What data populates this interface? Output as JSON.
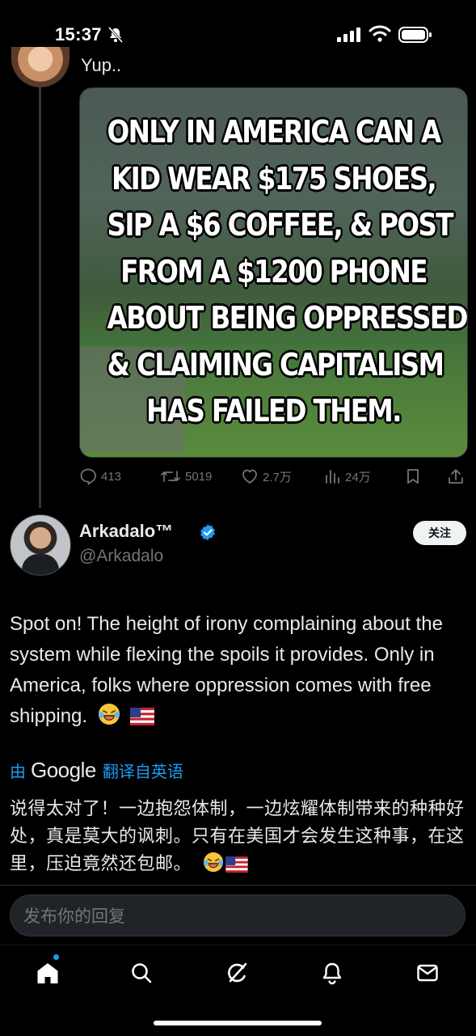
{
  "status_bar": {
    "time": "15:37"
  },
  "previous_post": {
    "text_fragment": "Yup..",
    "image_text_lines": [
      "ONLY IN AMERICA CAN A",
      "KID WEAR $175 SHOES,",
      "SIP A $6 COFFEE, & POST",
      "FROM A $1200 PHONE",
      "ABOUT BEING OPPRESSED",
      "& CLAIMING CAPITALISM",
      "HAS FAILED THEM."
    ],
    "actions": {
      "replies": "413",
      "reposts": "5019",
      "likes": "2.7万",
      "views": "24万"
    }
  },
  "reply_post": {
    "author_name": "Arkadalo™",
    "author_handle": "@Arkadalo",
    "follow_label": "关注",
    "text": "Spot on! The height of irony complaining about the system while flexing the spoils it provides. Only in America, folks where oppression comes with free shipping.",
    "translation": {
      "prefix": "由",
      "provider": "Google",
      "suffix": "翻译自英语",
      "text": "说得太对了！一边抱怨体制，一边炫耀体制带来的种种好处，真是莫大的讽刺。只有在美国才会发生这种事，在这里，压迫竟然还包邮。"
    }
  },
  "reply_input": {
    "placeholder": "发布你的回复"
  },
  "colors": {
    "accent": "#1d9bf0",
    "background": "#000000",
    "text_secondary": "#71767b"
  },
  "tab_bar": {
    "icons": [
      "home-icon",
      "search-icon",
      "grok-icon",
      "notifications-icon",
      "messages-icon"
    ]
  }
}
